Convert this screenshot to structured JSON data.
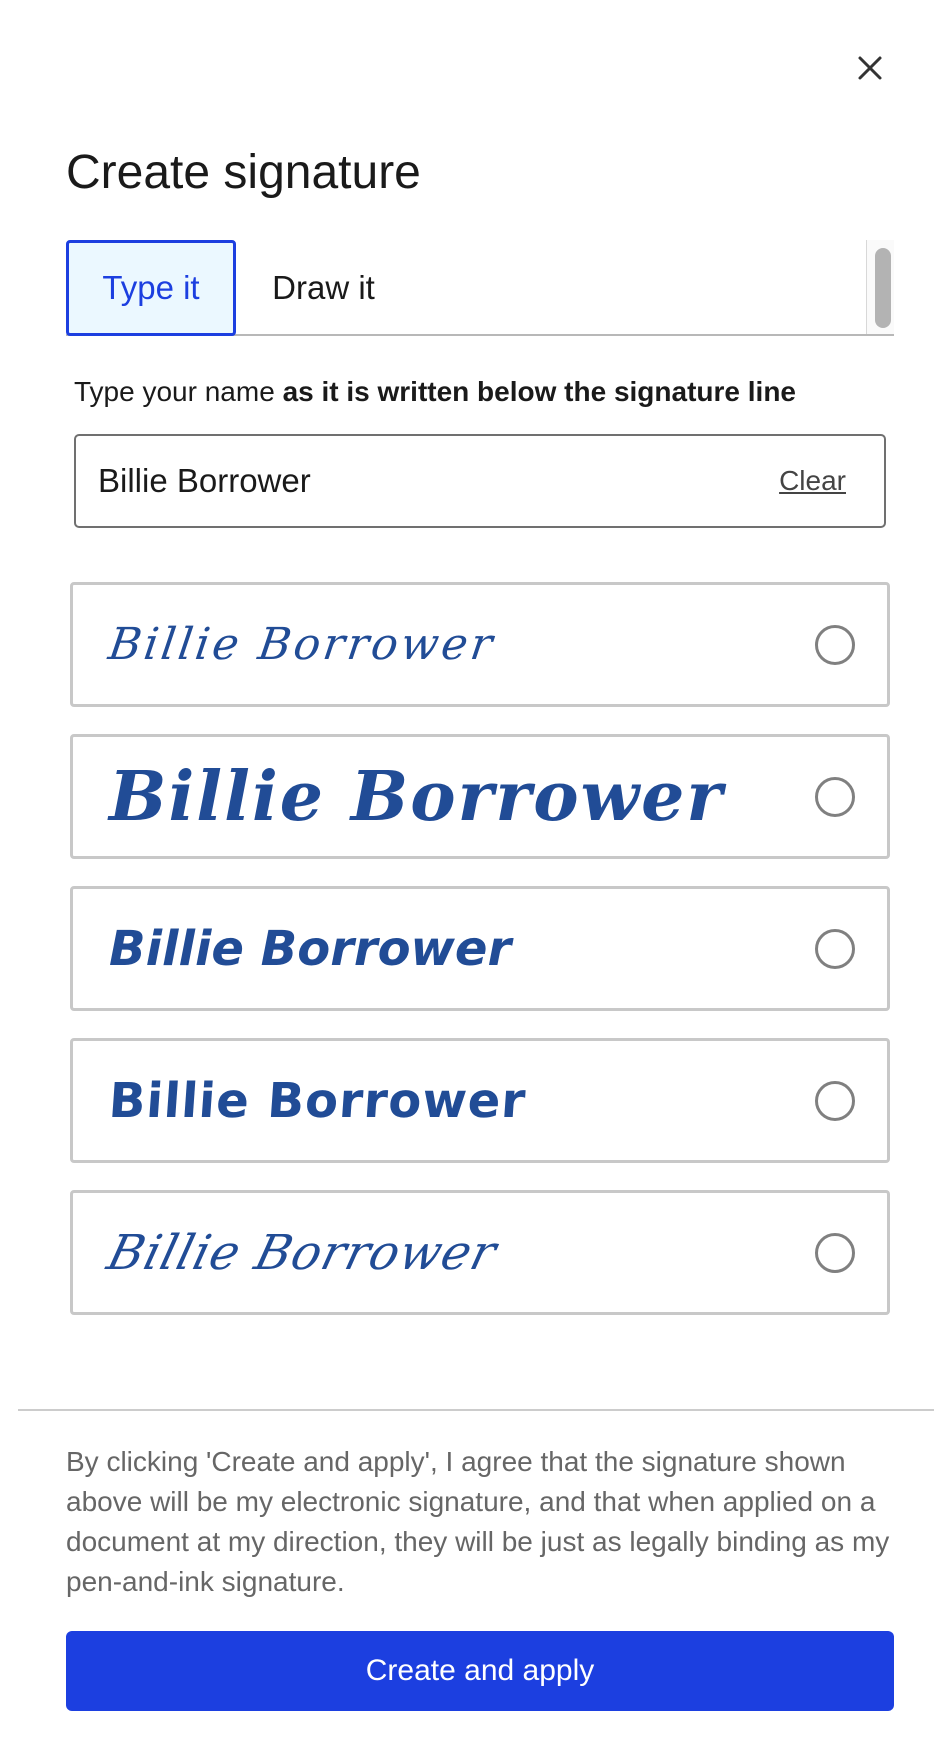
{
  "dialog": {
    "title": "Create signature",
    "close_icon": "close-icon"
  },
  "tabs": [
    {
      "label": "Type it",
      "selected": true
    },
    {
      "label": "Draw it",
      "selected": false
    }
  ],
  "instruction": {
    "prefix": "Type your name ",
    "bold": "as it is written below the signature line"
  },
  "name_input": {
    "value": "Billie Borrower",
    "clear_label": "Clear"
  },
  "signature_options": [
    {
      "text": "Billie Borrower",
      "selected": false
    },
    {
      "text": "Billie Borrower",
      "selected": false
    },
    {
      "text": "Billie Borrower",
      "selected": false
    },
    {
      "text": "Billie Borrower",
      "selected": false
    },
    {
      "text": "Billie Borrower",
      "selected": false
    }
  ],
  "legal_text": "By clicking 'Create and apply', I agree that the signature shown above will be my electronic signature, and that when applied on a document at my direction, they will be just as legally binding as my pen-and-ink signature.",
  "primary_button": {
    "label": "Create and apply"
  },
  "colors": {
    "accent": "#1c3fe0",
    "signature_ink": "#214c96",
    "tab_selected_bg": "#ebf8ff"
  }
}
